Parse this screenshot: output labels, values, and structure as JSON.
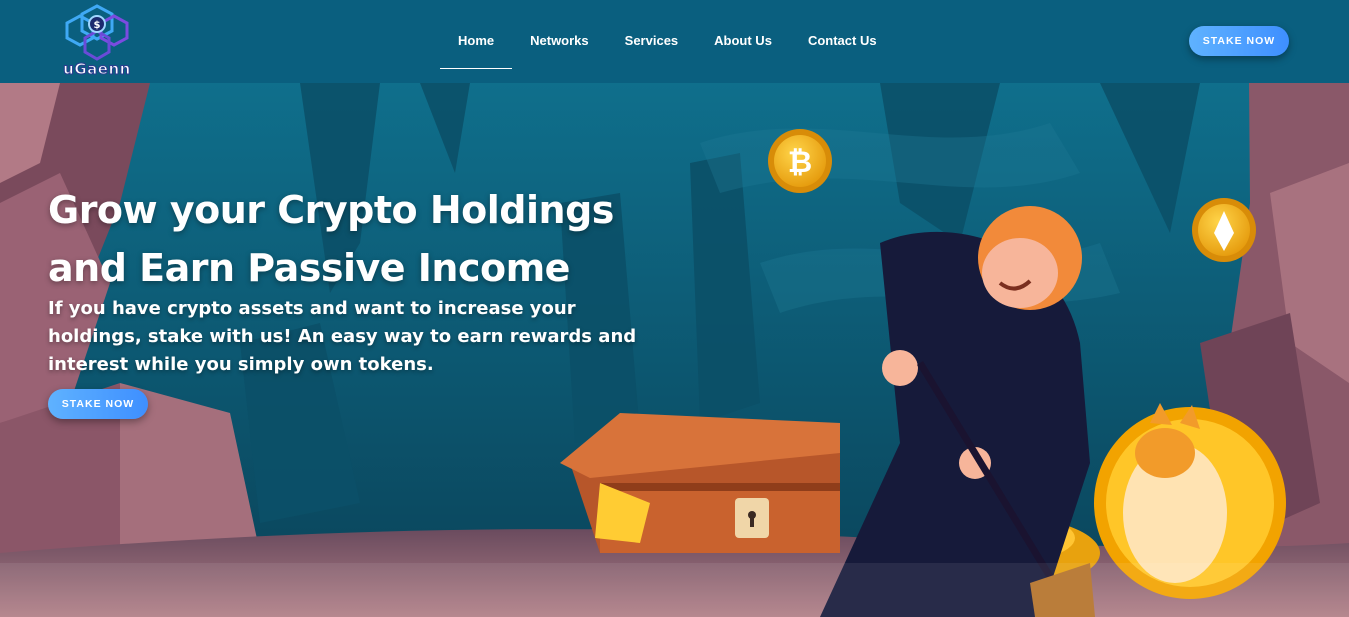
{
  "header": {
    "logo_text": "uGaenn",
    "nav": [
      {
        "label": "Home",
        "active": true
      },
      {
        "label": "Networks",
        "active": false
      },
      {
        "label": "Services",
        "active": false
      },
      {
        "label": "About Us",
        "active": false
      },
      {
        "label": "Contact Us",
        "active": false
      }
    ],
    "cta_label": "STAKE NOW"
  },
  "hero": {
    "title_line1": "Grow your Crypto Holdings",
    "title_line2": "and Earn Passive Income",
    "subtitle": "If you have crypto assets and want to increase your holdings, stake with us! An easy way to earn rewards and interest while you simply own tokens.",
    "cta_label": "STAKE NOW",
    "illustration": [
      "bitcoin-coin-icon",
      "token-coin-icon",
      "doge-coin-icon",
      "treasure-chest",
      "miner-character",
      "shovel"
    ]
  },
  "colors": {
    "navbar": "#0a5f7f",
    "button_gradient_start": "#5fb2ff",
    "button_gradient_end": "#3e8fff",
    "text": "#ffffff"
  }
}
